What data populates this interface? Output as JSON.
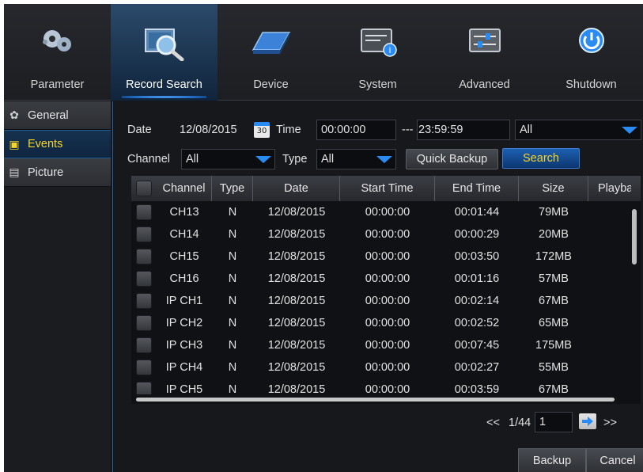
{
  "topmenu": [
    {
      "label": "Parameter",
      "icon": "gears-icon",
      "active": false
    },
    {
      "label": "Record Search",
      "icon": "magnifier-film-icon",
      "active": true
    },
    {
      "label": "Device",
      "icon": "hard-drive-icon",
      "active": false
    },
    {
      "label": "System",
      "icon": "system-info-icon",
      "active": false
    },
    {
      "label": "Advanced",
      "icon": "sliders-icon",
      "active": false
    },
    {
      "label": "Shutdown",
      "icon": "power-icon",
      "active": false
    }
  ],
  "sidebar": [
    {
      "label": "General",
      "icon": "film-reel-icon",
      "active": false
    },
    {
      "label": "Events",
      "icon": "calendar-list-icon",
      "active": true
    },
    {
      "label": "Picture",
      "icon": "picture-icon",
      "active": false
    }
  ],
  "filters": {
    "date_label": "Date",
    "date_value": "12/08/2015",
    "calendar_day": "30",
    "time_label": "Time",
    "time_start": "00:00:00",
    "time_sep": "---",
    "time_end": "23:59:59",
    "event_type": "All",
    "channel_label": "Channel",
    "channel_value": "All",
    "type_label": "Type",
    "type_value": "All",
    "quick_backup": "Quick Backup",
    "search": "Search"
  },
  "table": {
    "headers": [
      "Channel",
      "Type",
      "Date",
      "Start Time",
      "End Time",
      "Size",
      "Playba"
    ],
    "rows": [
      {
        "channel": "CH13",
        "type": "N",
        "date": "12/08/2015",
        "start": "00:00:00",
        "end": "00:01:44",
        "size": "79MB"
      },
      {
        "channel": "CH14",
        "type": "N",
        "date": "12/08/2015",
        "start": "00:00:00",
        "end": "00:00:29",
        "size": "20MB"
      },
      {
        "channel": "CH15",
        "type": "N",
        "date": "12/08/2015",
        "start": "00:00:00",
        "end": "00:03:50",
        "size": "172MB"
      },
      {
        "channel": "CH16",
        "type": "N",
        "date": "12/08/2015",
        "start": "00:00:00",
        "end": "00:01:16",
        "size": "57MB"
      },
      {
        "channel": "IP CH1",
        "type": "N",
        "date": "12/08/2015",
        "start": "00:00:00",
        "end": "00:02:14",
        "size": "67MB"
      },
      {
        "channel": "IP CH2",
        "type": "N",
        "date": "12/08/2015",
        "start": "00:00:00",
        "end": "00:02:52",
        "size": "65MB"
      },
      {
        "channel": "IP CH3",
        "type": "N",
        "date": "12/08/2015",
        "start": "00:00:00",
        "end": "00:07:45",
        "size": "175MB"
      },
      {
        "channel": "IP CH4",
        "type": "N",
        "date": "12/08/2015",
        "start": "00:00:00",
        "end": "00:02:27",
        "size": "55MB"
      },
      {
        "channel": "IP CH5",
        "type": "N",
        "date": "12/08/2015",
        "start": "00:00:00",
        "end": "00:03:59",
        "size": "67MB"
      }
    ]
  },
  "pager": {
    "prev": "<<",
    "page_info": "1/44",
    "page_input": "1",
    "next": ">>"
  },
  "actions": {
    "backup": "Backup",
    "cancel": "Cancel"
  },
  "colors": {
    "accent_blue": "#2a8bf2",
    "active_text": "#f6d629",
    "background": "#16181c"
  }
}
